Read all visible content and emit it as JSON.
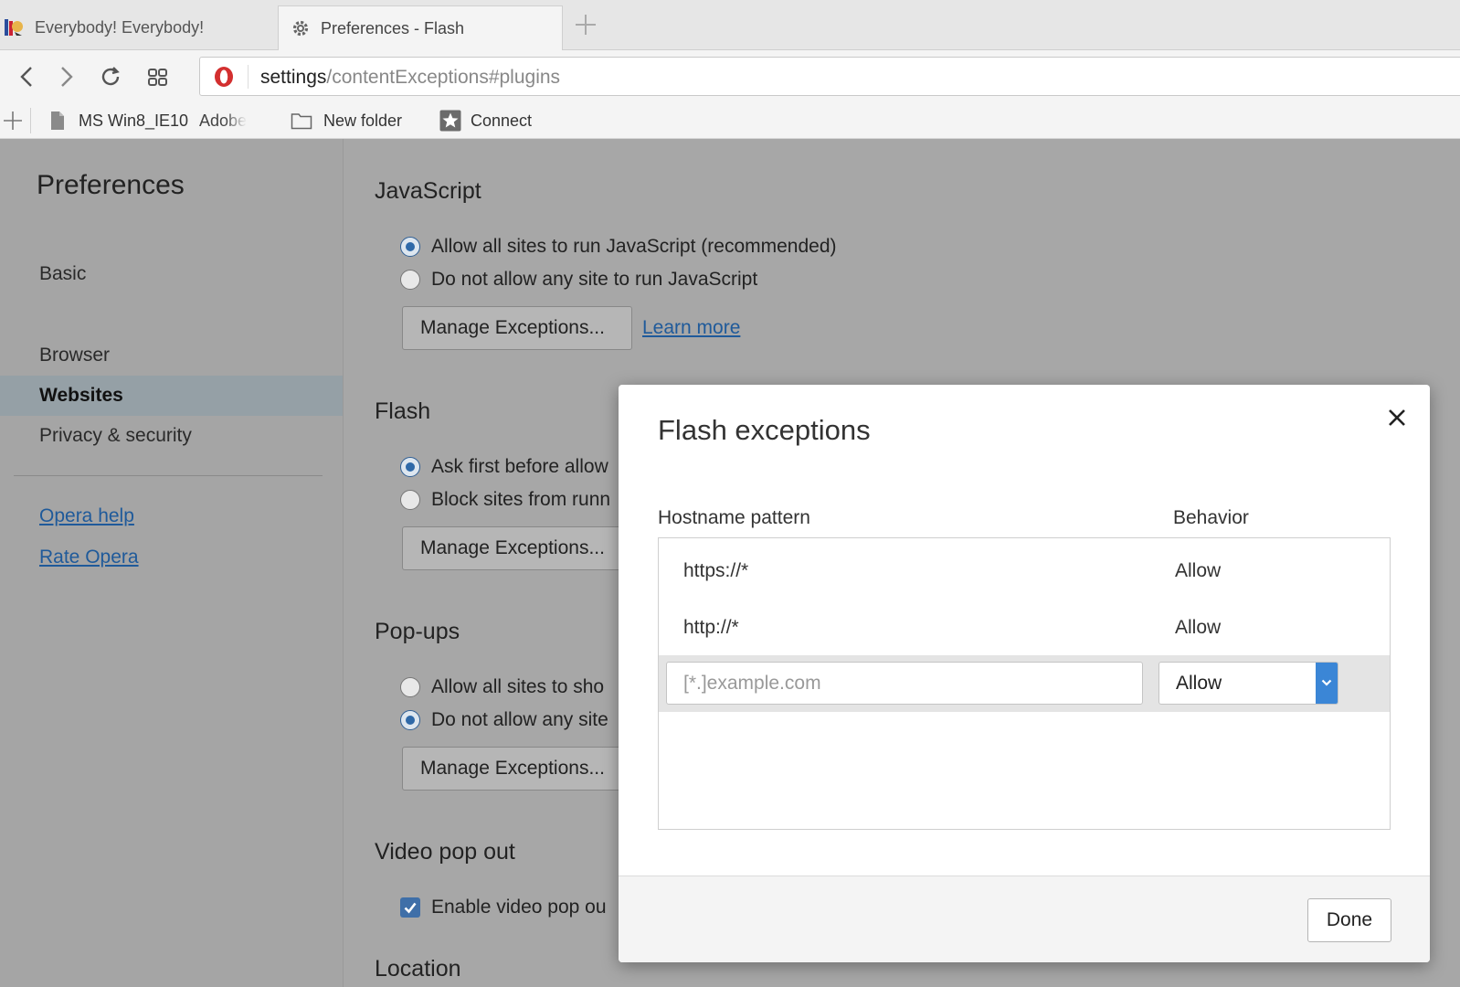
{
  "tabs": [
    {
      "title": "Everybody! Everybody!",
      "icon": "site-favicon-icon"
    },
    {
      "title": "Preferences - Flash",
      "icon": "gear-icon",
      "active": true
    }
  ],
  "toolbar": {
    "url_host": "settings",
    "url_path": "/contentExceptions#plugins"
  },
  "bookmarks": [
    {
      "label": "MS Win8_IE10",
      "icon": "page-icon"
    },
    {
      "label": "Adobe",
      "icon": ""
    },
    {
      "label": "New folder",
      "icon": "folder-icon"
    },
    {
      "label": "Connect",
      "icon": "star-icon"
    }
  ],
  "sidebar": {
    "title": "Preferences",
    "items": [
      {
        "label": "Basic"
      },
      {
        "label": "Browser"
      },
      {
        "label": "Websites",
        "active": true
      },
      {
        "label": "Privacy & security"
      }
    ],
    "links": [
      {
        "label": "Opera help"
      },
      {
        "label": "Rate Opera"
      }
    ]
  },
  "content": {
    "javascript": {
      "title": "JavaScript",
      "options": [
        {
          "label": "Allow all sites to run JavaScript (recommended)",
          "selected": true
        },
        {
          "label": "Do not allow any site to run JavaScript",
          "selected": false
        }
      ],
      "manage_label": "Manage Exceptions...",
      "learn_more": "Learn more"
    },
    "flash": {
      "title": "Flash",
      "options": [
        {
          "label": "Ask first before allow",
          "selected": true
        },
        {
          "label": "Block sites from runn",
          "selected": false
        }
      ],
      "manage_label": "Manage Exceptions..."
    },
    "popups": {
      "title": "Pop-ups",
      "options": [
        {
          "label": "Allow all sites to sho",
          "selected": false
        },
        {
          "label": "Do not allow any site",
          "selected": true
        }
      ],
      "manage_label": "Manage Exceptions..."
    },
    "video": {
      "title": "Video pop out",
      "checkbox_label": "Enable video pop ou",
      "checked": true
    },
    "location": {
      "title": "Location"
    }
  },
  "dialog": {
    "title": "Flash exceptions",
    "col_hostname": "Hostname pattern",
    "col_behavior": "Behavior",
    "rows": [
      {
        "pattern": "https://*",
        "behavior": "Allow"
      },
      {
        "pattern": "http://*",
        "behavior": "Allow"
      }
    ],
    "input_placeholder": "[*.]example.com",
    "select_value": "Allow",
    "done_label": "Done"
  },
  "colors": {
    "accent": "#3b86d6",
    "link": "#1f5a9a",
    "overlay_gray": "#a7a7a7"
  }
}
